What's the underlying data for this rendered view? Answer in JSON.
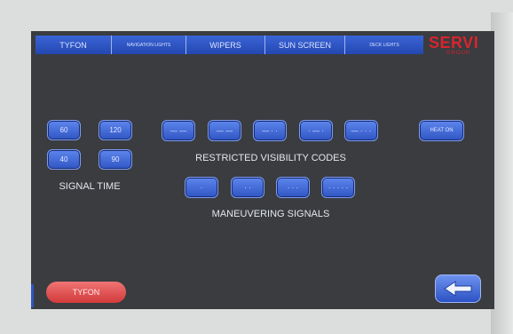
{
  "tabs": [
    "TYFON",
    "NAVIGATION LIGHTS",
    "WIPERS",
    "SUN SCREEN",
    "DECK LIGHTS"
  ],
  "logo": {
    "main": "SERVI",
    "sub": "GROUP"
  },
  "signal_time": {
    "label": "SIGNAL TIME",
    "buttons": [
      "60",
      "120",
      "40",
      "90"
    ]
  },
  "restricted_visibility": {
    "label": "RESTRICTED VISIBILITY CODES",
    "codes": [
      "— —",
      "— —",
      "— · ·",
      "· — ·",
      "— · · ·"
    ]
  },
  "maneuvering": {
    "label": "MANEUVERING SIGNALS",
    "codes": [
      "·",
      "· ·",
      "· · ·",
      "· · · · ·"
    ]
  },
  "heat_button": "HEAT ON",
  "tyfon_button": "TYFON",
  "colors": {
    "accent": "#2f55c2",
    "alert": "#d23a3a",
    "brand": "#d8252e"
  }
}
